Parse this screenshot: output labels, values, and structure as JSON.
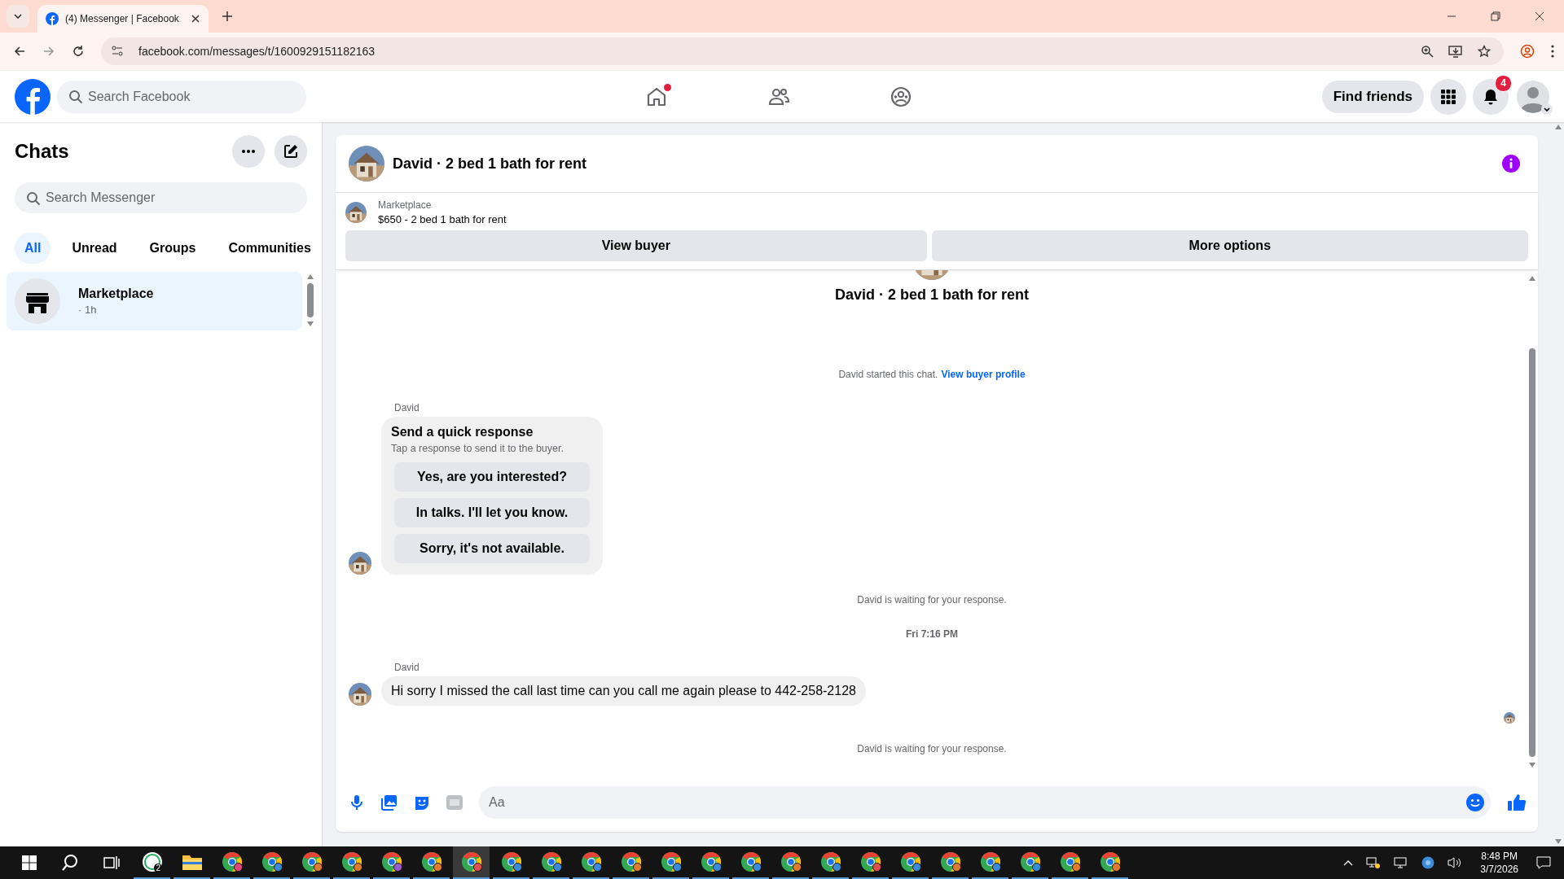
{
  "browser": {
    "tab_title": "(4) Messenger | Facebook",
    "url": "facebook.com/messages/t/1600929151182163"
  },
  "topbar": {
    "search_placeholder": "Search Facebook",
    "nav": [
      {
        "kind": "home",
        "unread": true
      },
      {
        "kind": "friends",
        "unread": false
      },
      {
        "kind": "groups",
        "unread": false
      }
    ],
    "find_friends": "Find friends",
    "notification_count": "4"
  },
  "sidebar": {
    "title": "Chats",
    "search_placeholder": "Search Messenger",
    "filters": [
      {
        "label": "All",
        "selected": true
      },
      {
        "label": "Unread",
        "selected": false
      },
      {
        "label": "Groups",
        "selected": false
      },
      {
        "label": "Communities",
        "selected": false
      }
    ],
    "chats": [
      {
        "name": "Marketplace",
        "time": "· 1h",
        "selected": true
      }
    ]
  },
  "chat": {
    "title": "David · 2 bed 1 bath for rent",
    "listing": {
      "source": "Marketplace",
      "summary": "$650 - 2 bed 1 bath for rent"
    },
    "actions": [
      "View buyer",
      "More options"
    ],
    "intro_title": "David · 2 bed 1 bath for rent",
    "messages": [
      {
        "kind": "notice",
        "text": "David started this chat.",
        "link": "View buyer profile"
      },
      {
        "kind": "quick_response",
        "sender": "David",
        "title": "Send a quick response",
        "subtitle": "Tap a response to send it to the buyer.",
        "options": [
          "Yes, are you interested?",
          "In talks. I'll let you know.",
          "Sorry, it's not available."
        ]
      },
      {
        "kind": "notice",
        "text": "David is waiting for your response."
      },
      {
        "kind": "timestamp",
        "text": "Fri 7:16 PM"
      },
      {
        "kind": "text",
        "sender": "David",
        "text": "Hi sorry I missed the call last time can you call me again please to 442-258-2128",
        "seen": true
      },
      {
        "kind": "notice",
        "text": "David is waiting for your response."
      }
    ],
    "composer_placeholder": "Aa"
  },
  "taskbar": {
    "apps": [
      {
        "kind": "whatsapp",
        "badge": "2",
        "selected": false
      },
      {
        "kind": "explorer",
        "selected": false
      },
      {
        "kind": "chrome",
        "color": "#e0457b",
        "selected": false
      },
      {
        "kind": "chrome",
        "color": "#3b8ad8",
        "selected": false
      },
      {
        "kind": "chrome",
        "color": "#e07a2e",
        "selected": false
      },
      {
        "kind": "chrome",
        "color": "#e07a2e",
        "selected": false
      },
      {
        "kind": "chrome",
        "color": "#9b59d0",
        "selected": false
      },
      {
        "kind": "chrome",
        "color": "#e07a2e",
        "selected": false
      },
      {
        "kind": "chrome",
        "color": "#e05050",
        "selected": true
      },
      {
        "kind": "chrome",
        "color": "#3b8ad8",
        "selected": false
      },
      {
        "kind": "chrome",
        "color": "#3b8ad8",
        "selected": false
      },
      {
        "kind": "chrome",
        "color": "#3b8ad8",
        "selected": false
      },
      {
        "kind": "chrome",
        "color": "#e07a2e",
        "selected": false
      },
      {
        "kind": "chrome",
        "color": "#3b8ad8",
        "selected": false
      },
      {
        "kind": "chrome",
        "color": "#3b8ad8",
        "selected": false
      },
      {
        "kind": "chrome",
        "color": "#3b8ad8",
        "selected": false
      },
      {
        "kind": "chrome",
        "color": "#e07a2e",
        "selected": false
      },
      {
        "kind": "chrome",
        "color": "#3b8ad8",
        "selected": false
      },
      {
        "kind": "chrome",
        "color": "#e05050",
        "selected": false
      },
      {
        "kind": "chrome",
        "color": "#3b8ad8",
        "selected": false
      },
      {
        "kind": "chrome",
        "color": "#e07a2e",
        "selected": false
      },
      {
        "kind": "chrome",
        "color": "#3b8ad8",
        "selected": false
      },
      {
        "kind": "chrome",
        "color": "#3b8ad8",
        "selected": false
      },
      {
        "kind": "chrome",
        "color": "#e07a2e",
        "selected": false
      },
      {
        "kind": "chrome",
        "color": "#e07a2e",
        "selected": false
      }
    ],
    "time": "8:48 PM",
    "date": "3/7/2026"
  }
}
